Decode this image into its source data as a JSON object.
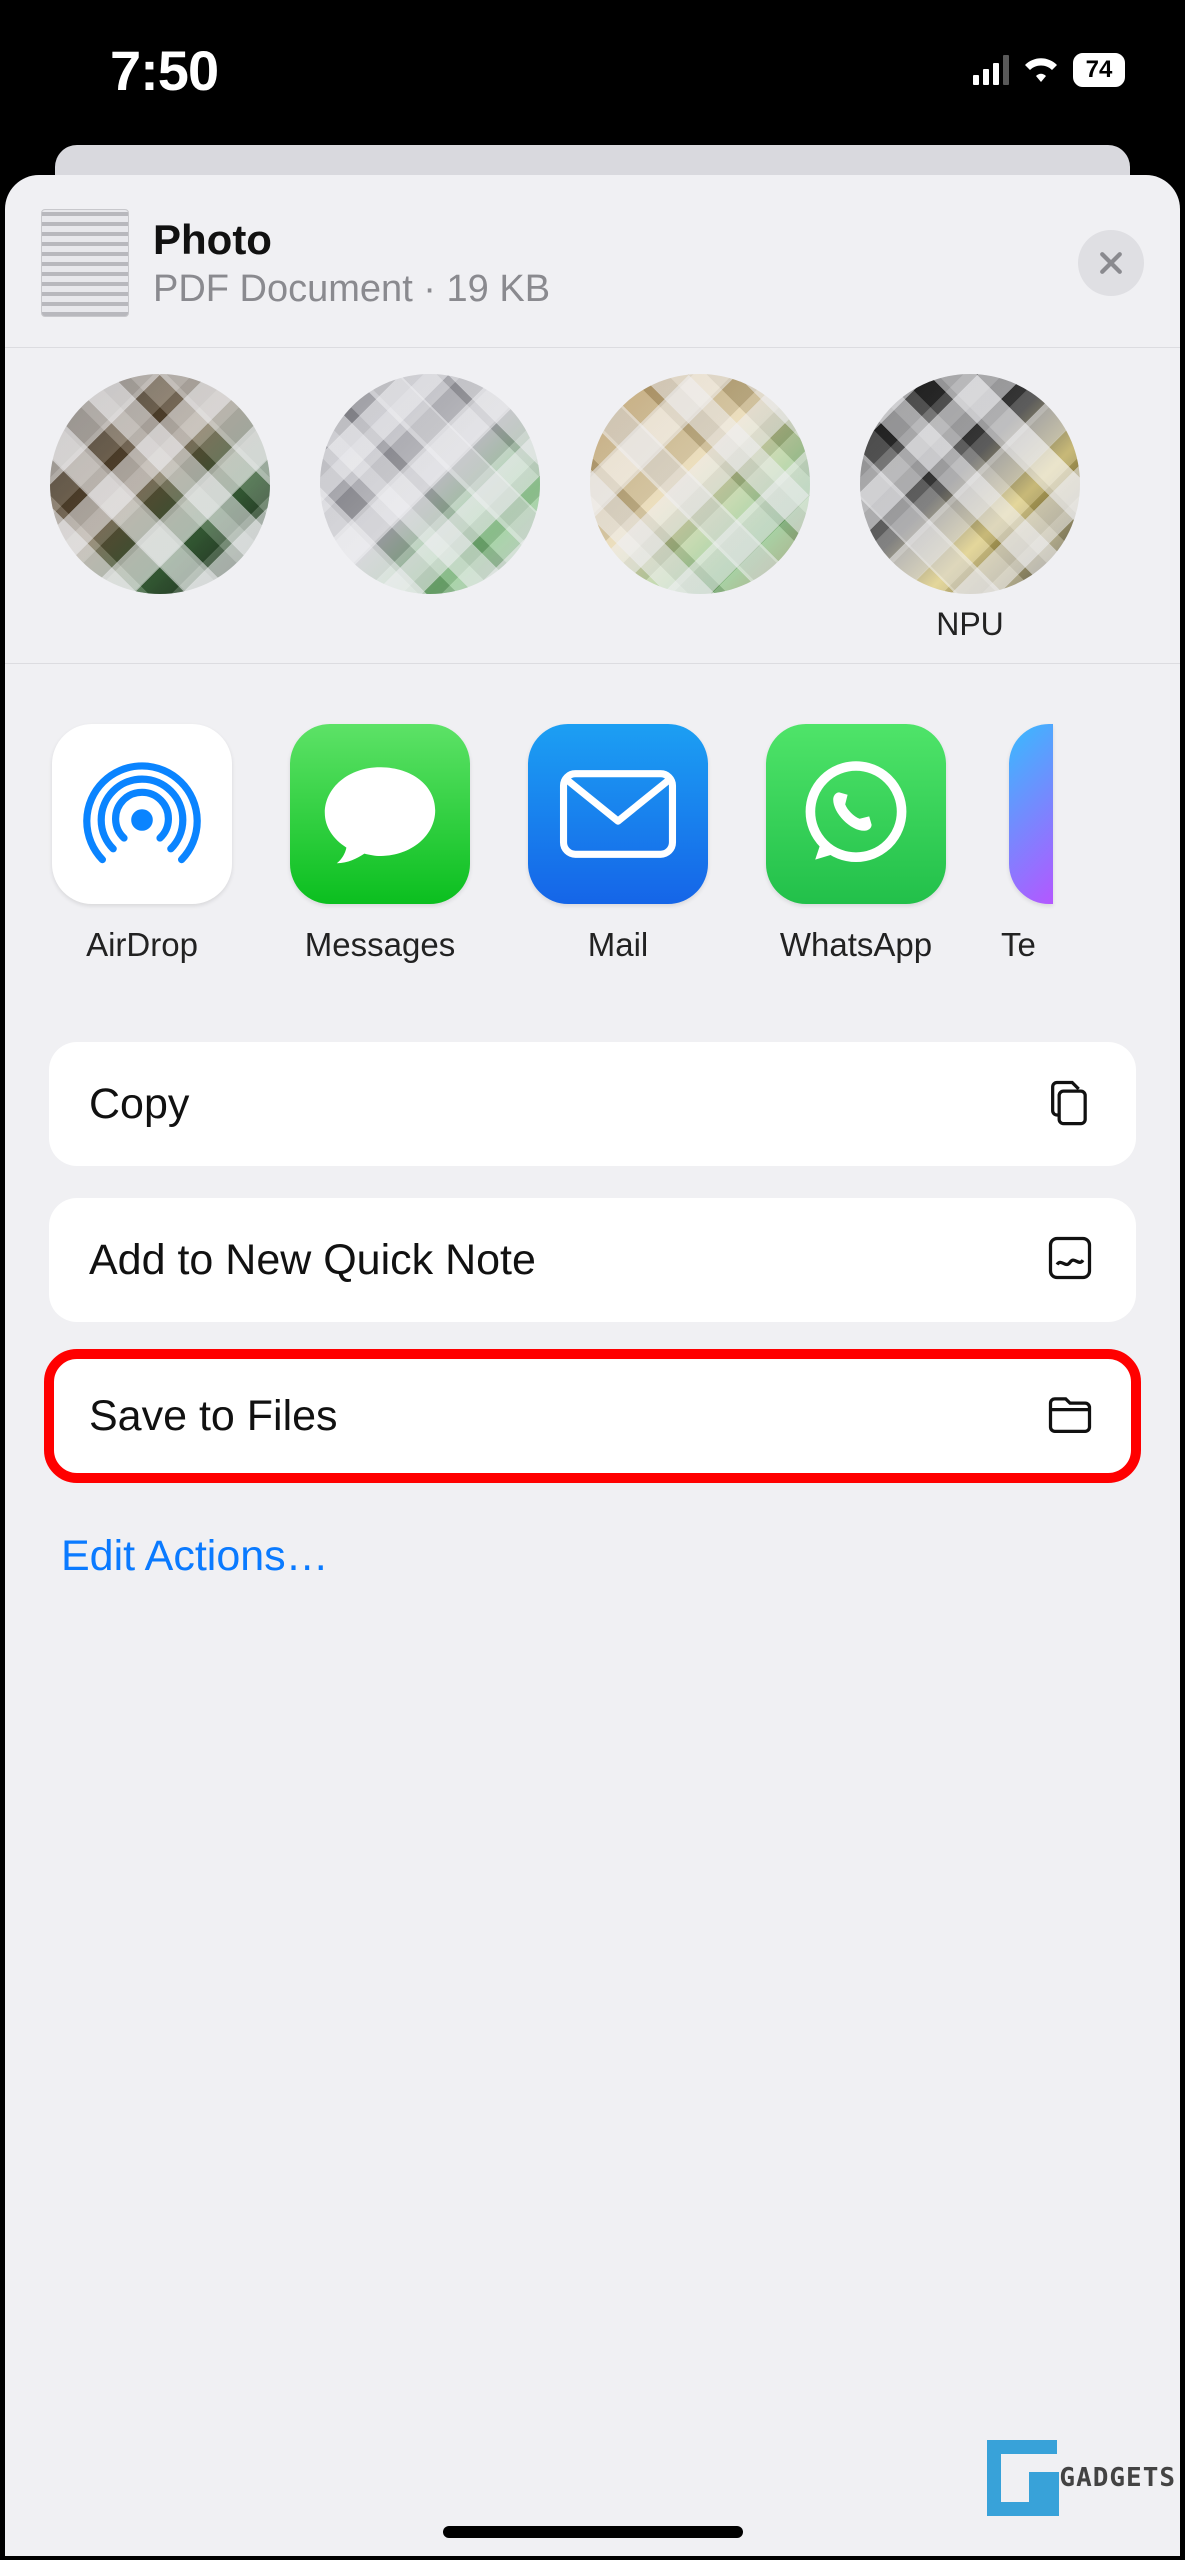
{
  "status": {
    "time": "7:50",
    "battery": "74"
  },
  "header": {
    "title": "Photo",
    "subtitle": "PDF Document · 19 KB"
  },
  "contacts": [
    {
      "name": ""
    },
    {
      "name": ""
    },
    {
      "name": ""
    },
    {
      "name": "NPU"
    }
  ],
  "apps": [
    {
      "label": "AirDrop"
    },
    {
      "label": "Messages"
    },
    {
      "label": "Mail"
    },
    {
      "label": "WhatsApp"
    },
    {
      "label": "Te"
    }
  ],
  "actions": {
    "copy": "Copy",
    "quicknote": "Add to New Quick Note",
    "savefiles": "Save to Files",
    "edit": "Edit Actions…"
  },
  "watermark": "GADGETS"
}
